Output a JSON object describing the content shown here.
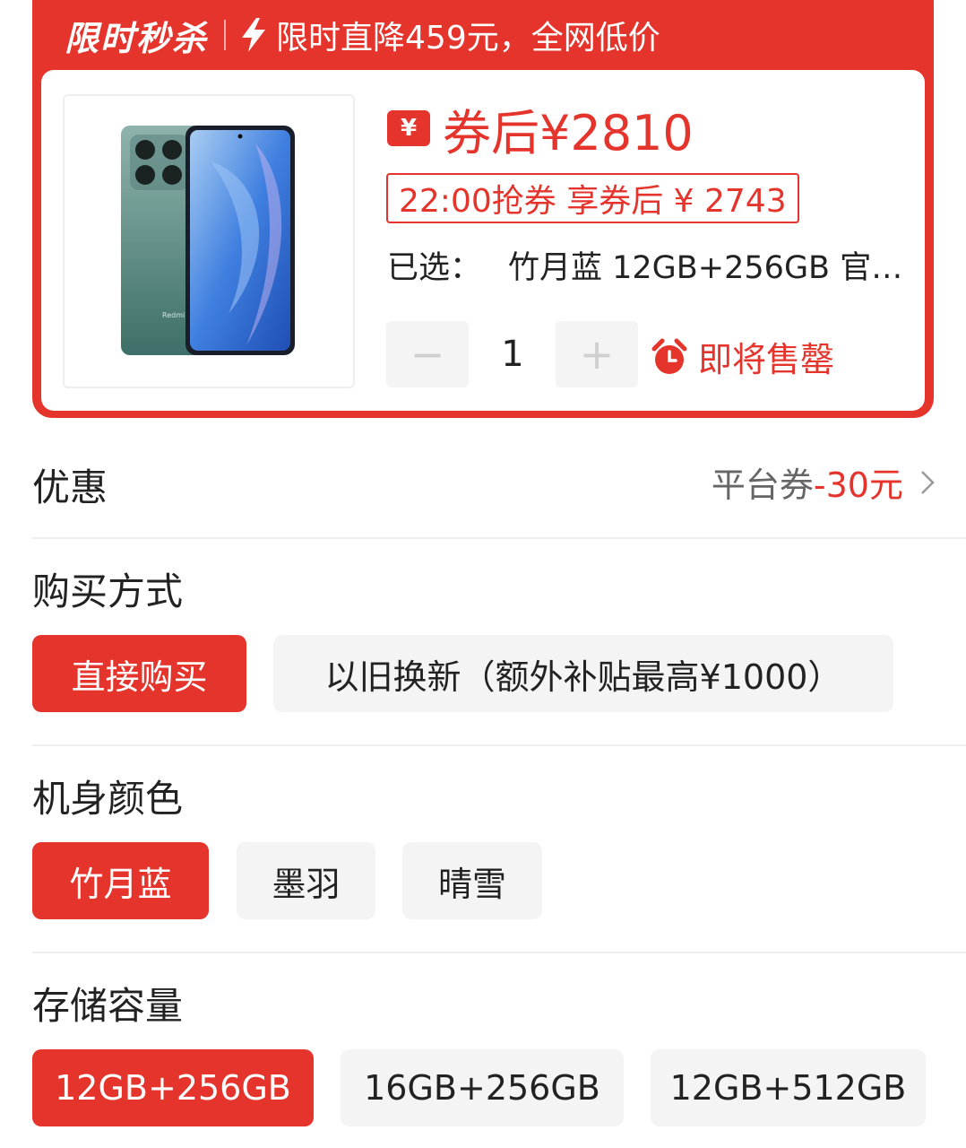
{
  "flash": {
    "tag": "限时秒杀",
    "text": "限时直降459元，全网低价"
  },
  "product": {
    "price_label": "券后¥2810",
    "yen_icon": "¥",
    "coupon": "22:00抢券 享券后 ¥ 2743",
    "selected_label": "已选：",
    "selected_value": "竹月蓝 12GB+256GB 官…",
    "quantity": "1",
    "minus": "−",
    "plus": "+",
    "sellout": "即将售罄",
    "phone_brand": "Redmi"
  },
  "promo": {
    "label": "优惠",
    "value_prefix": "平台券",
    "value_amount": "-30元"
  },
  "purchase": {
    "label": "购买方式",
    "options": [
      "直接购买",
      "以旧换新（额外补贴最高¥1000）"
    ]
  },
  "color": {
    "label": "机身颜色",
    "options": [
      "竹月蓝",
      "墨羽",
      "晴雪"
    ]
  },
  "storage": {
    "label": "存储容量",
    "options": [
      "12GB+256GB",
      "16GB+256GB",
      "12GB+512GB"
    ]
  },
  "colors": {
    "accent": "#e5342c",
    "chip_bg": "#f4f4f4"
  }
}
